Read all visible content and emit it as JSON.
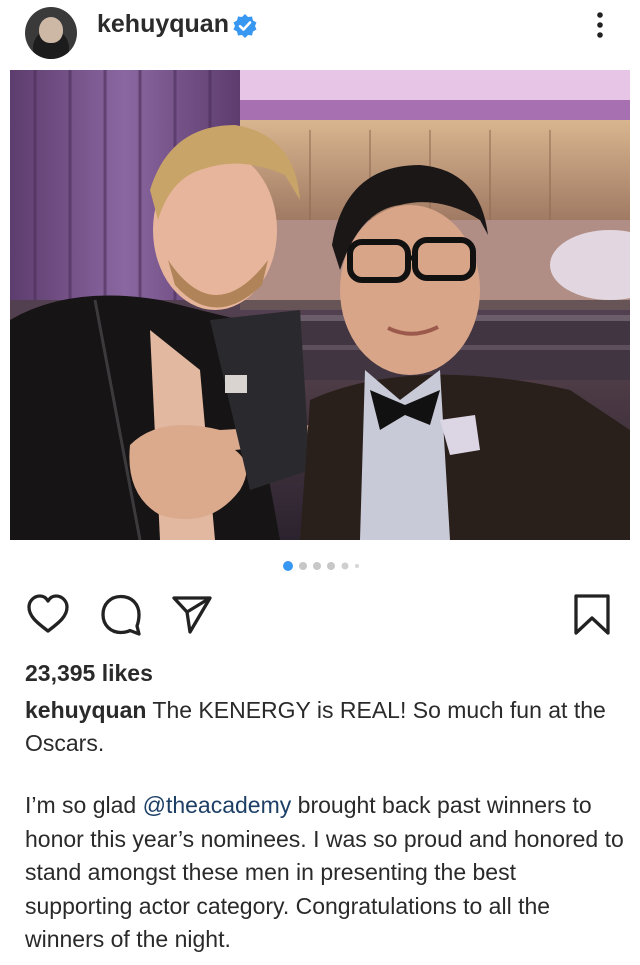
{
  "post": {
    "username": "kehuyquan",
    "likes": "23,395 likes",
    "caption_username": "kehuyquan",
    "caption_text": "The KENERGY is REAL! So much fun at the Oscars.",
    "body_before_mention": "I’m so glad ",
    "mention": "@theacademy",
    "body_after_mention": " brought back past winners to honor this year’s nominees. I was so proud and honored to stand amongst these men in presenting the best supporting actor category. Congratulations to all the winners of the night."
  },
  "carousel": {
    "total": 6,
    "active_index": 0
  },
  "colors": {
    "accent": "#3897f0",
    "verified": "#3897f0",
    "mention": "#1d3f66"
  },
  "icons": [
    "verified-badge-icon",
    "more-options-icon",
    "heart-icon",
    "comment-icon",
    "share-icon",
    "bookmark-icon"
  ]
}
